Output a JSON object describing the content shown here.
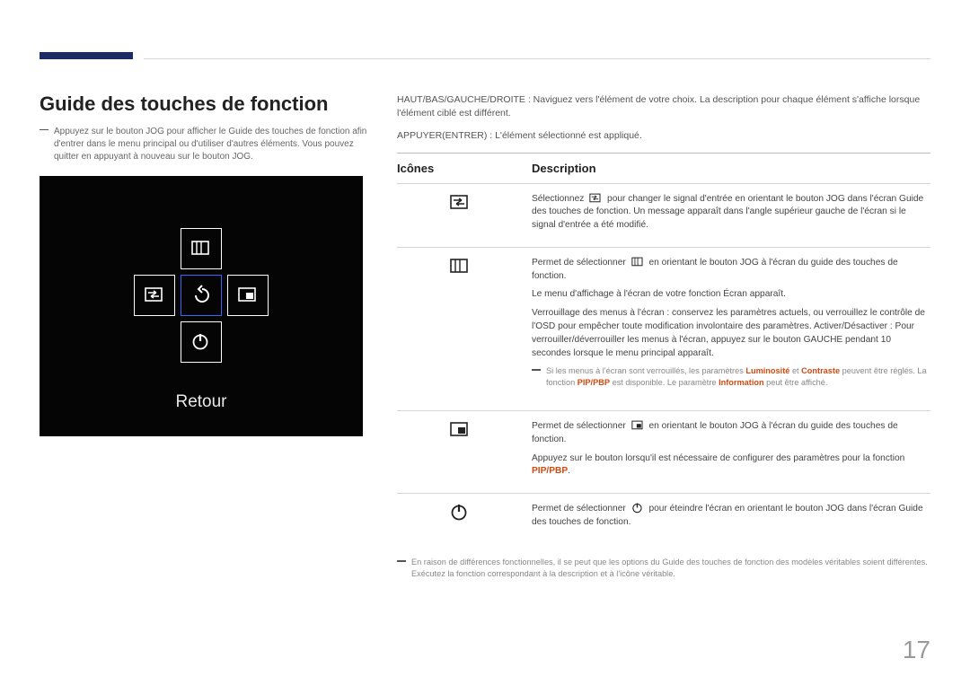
{
  "page_number": "17",
  "heading": "Guide des touches de fonction",
  "left_note": "Appuyez sur le bouton JOG pour afficher le Guide des touches de fonction afin d'entrer dans le menu principal ou d'utiliser d'autres éléments. Vous pouvez quitter en appuyant à nouveau sur le bouton JOG.",
  "osd": {
    "label": "Retour"
  },
  "right_intro_1": "HAUT/BAS/GAUCHE/DROITE : Naviguez vers l'élément de votre choix. La description pour chaque élément s'affiche lorsque l'élément ciblé est différent.",
  "right_intro_2": "APPUYER(ENTRER) : L'élément sélectionné est appliqué.",
  "table": {
    "col_icon": "Icônes",
    "col_desc": "Description",
    "rows": [
      {
        "icon": "source",
        "desc_pre": "Sélectionnez",
        "desc_post": "pour changer le signal d'entrée en orientant le bouton JOG dans l'écran Guide des touches de fonction. Un message apparaît dans l'angle supérieur gauche de l'écran si le signal d'entrée a été modifié."
      },
      {
        "icon": "menu",
        "desc_pre": "Permet de sélectionner",
        "desc_post": "en orientant le bouton JOG à l'écran du guide des touches de fonction.",
        "p2": "Le menu d'affichage à l'écran de votre fonction Écran apparaît.",
        "p3": "Verrouillage des menus à l'écran : conservez les paramètres actuels, ou verrouillez le contrôle de l'OSD pour empêcher toute modification involontaire des paramètres. Activer/Désactiver : Pour verrouiller/déverrouiller les menus à l'écran, appuyez sur le bouton GAUCHE pendant 10 secondes lorsque le menu principal apparaît.",
        "note_a": "Si les menus à l'écran sont verrouillés, les paramètres",
        "note_b": "et",
        "note_c": "peuvent être réglés. La fonction",
        "note_d": "est disponible. Le paramètre",
        "note_e": "peut être affiché.",
        "hl_lum": "Luminosité",
        "hl_con": "Contraste",
        "hl_pip": "PIP/PBP",
        "hl_info": "Information"
      },
      {
        "icon": "pip",
        "desc_pre": "Permet de sélectionner",
        "desc_post": "en orientant le bouton JOG à l'écran du guide des touches de fonction.",
        "p2a": "Appuyez sur le bouton lorsqu'il est nécessaire de configurer des paramètres pour la fonction",
        "p2_hl": "PIP/PBP",
        "p2b": "."
      },
      {
        "icon": "power",
        "desc_pre": "Permet de sélectionner",
        "desc_post": "pour éteindre l'écran en orientant le bouton JOG dans l'écran Guide des touches de fonction."
      }
    ]
  },
  "footer_note": "En raison de différences fonctionnelles, il se peut que les options du Guide des touches de fonction des modèles véritables soient différentes. Exécutez la fonction correspondant à la description et à l'icône véritable."
}
